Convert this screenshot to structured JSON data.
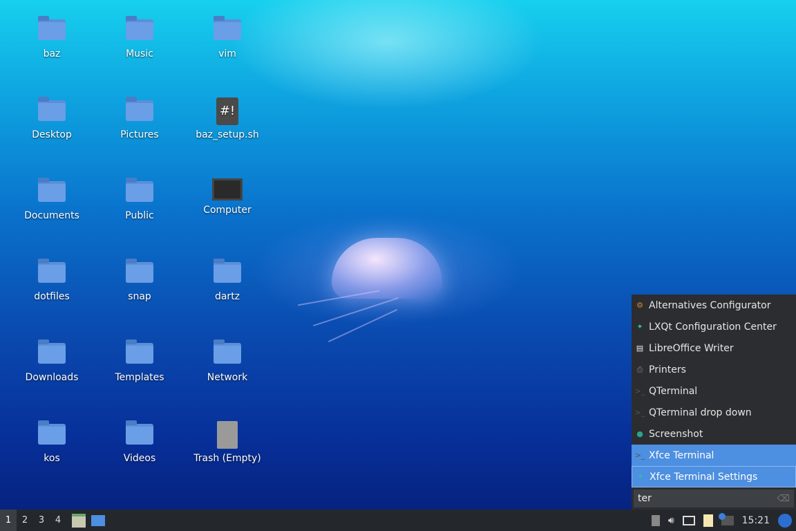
{
  "desktop": {
    "icons": [
      {
        "label": "baz",
        "type": "folder"
      },
      {
        "label": "Music",
        "type": "folder"
      },
      {
        "label": "vim",
        "type": "folder"
      },
      {
        "label": "Desktop",
        "type": "folder"
      },
      {
        "label": "Pictures",
        "type": "folder"
      },
      {
        "label": "baz_setup.sh",
        "type": "script",
        "glyph_text": "#!"
      },
      {
        "label": "Documents",
        "type": "folder"
      },
      {
        "label": "Public",
        "type": "folder"
      },
      {
        "label": "Computer",
        "type": "computer"
      },
      {
        "label": "dotfiles",
        "type": "folder"
      },
      {
        "label": "snap",
        "type": "folder"
      },
      {
        "label": "dartz",
        "type": "folder"
      },
      {
        "label": "Downloads",
        "type": "folder"
      },
      {
        "label": "Templates",
        "type": "folder"
      },
      {
        "label": "Network",
        "type": "folder"
      },
      {
        "label": "kos",
        "type": "folder"
      },
      {
        "label": "Videos",
        "type": "folder"
      },
      {
        "label": "Trash (Empty)",
        "type": "trash"
      }
    ]
  },
  "menu": {
    "items": [
      {
        "label": "Alternatives Configurator",
        "icon": "gear-icon",
        "state": ""
      },
      {
        "label": "LXQt Configuration Center",
        "icon": "settings-icon",
        "state": ""
      },
      {
        "label": "LibreOffice Writer",
        "icon": "document-icon",
        "state": ""
      },
      {
        "label": "Printers",
        "icon": "printer-icon",
        "state": ""
      },
      {
        "label": "QTerminal",
        "icon": "terminal-icon",
        "state": ""
      },
      {
        "label": "QTerminal drop down",
        "icon": "terminal-icon",
        "state": ""
      },
      {
        "label": "Screenshot",
        "icon": "camera-icon",
        "state": ""
      },
      {
        "label": "Xfce Terminal",
        "icon": "terminal-icon",
        "state": "selected"
      },
      {
        "label": "Xfce Terminal Settings",
        "icon": "settings-icon",
        "state": "focused"
      }
    ],
    "search": {
      "value": "ter"
    }
  },
  "taskbar": {
    "workspaces": [
      "1",
      "2",
      "3",
      "4"
    ],
    "clock": "15:21"
  },
  "colors": {
    "menu_bg": "#2b2d30",
    "selection": "#4d8fe0",
    "taskbar_bg": "#24282d"
  }
}
